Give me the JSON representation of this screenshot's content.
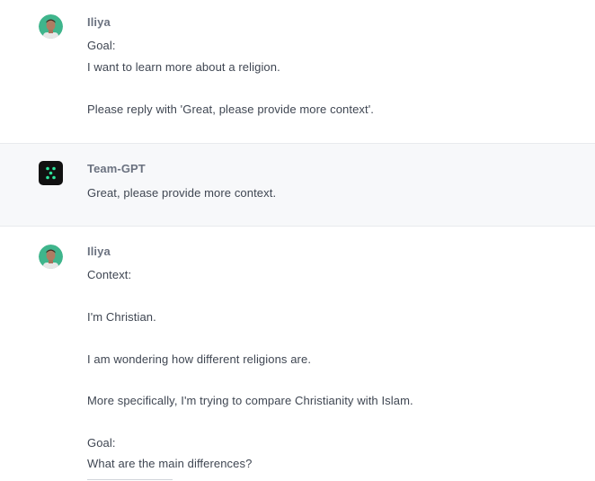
{
  "messages": [
    {
      "author": "Iliya",
      "avatar_icon": "user-avatar",
      "lines": [
        "Goal:",
        "I want to learn more about a religion.",
        "Please reply with 'Great, please provide more context'."
      ]
    },
    {
      "author": "Team-GPT",
      "avatar_icon": "team-gpt-logo",
      "accent_color": "#2ee59d",
      "lines": [
        "Great, please provide more context."
      ]
    },
    {
      "author": "Iliya",
      "avatar_icon": "user-avatar",
      "lines": [
        "Context:",
        "I'm Christian.",
        "I am wondering how different religions are.",
        "More specifically, I'm trying to compare Christianity with Islam.",
        "Goal:",
        "What are the main differences?"
      ]
    }
  ]
}
